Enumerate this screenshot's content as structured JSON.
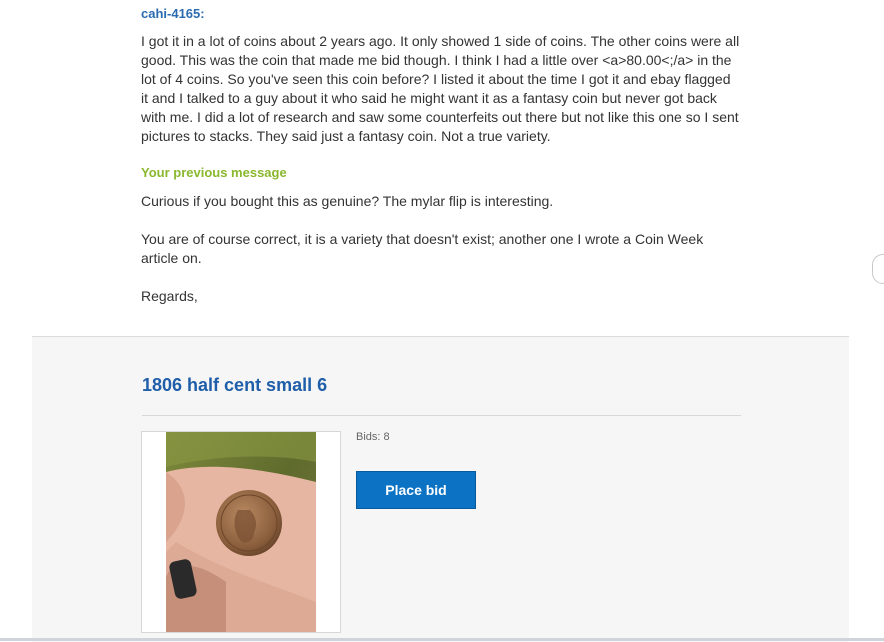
{
  "message": {
    "sender": "cahi-4165:",
    "body": "I got it in a lot of coins about 2 years ago. It only showed 1 side of coins. The other coins were all good. This was the coin that made me bid though. I think I had a little over <a>80.00<;/a> in the lot of 4 coins. So you've seen this coin before? I listed it about the time I got it and ebay flagged it and I talked to a guy about it who said he might want it as a fantasy coin but never got back with me. I did a lot of research and saw some counterfeits out there but not like this one so I sent pictures to stacks. They said just a fantasy coin. Not a true variety."
  },
  "previous_message": {
    "label": "Your previous message",
    "paragraphs": [
      "Curious if you bought this as genuine? The mylar flip is interesting.",
      "You are of course correct, it is a variety that doesn't exist; another one I wrote a Coin Week article on.",
      "Regards,"
    ]
  },
  "listing": {
    "title": "1806 half cent small 6",
    "bids": "Bids: 8",
    "button_label": "Place bid",
    "image_icon": "coin-in-hand-photo"
  }
}
